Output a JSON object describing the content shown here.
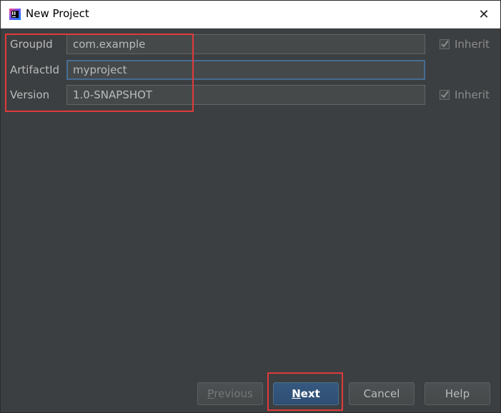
{
  "window": {
    "title": "New Project",
    "app_icon": "intellij-idea-icon",
    "close_icon": "close-icon",
    "close_glyph": "✕"
  },
  "form": {
    "group_id": {
      "label": "GroupId",
      "value": "com.example",
      "inherit_label": "Inherit",
      "inherit_checked": true
    },
    "artifact_id": {
      "label": "ArtifactId",
      "value": "myproject"
    },
    "version": {
      "label": "Version",
      "value": "1.0-SNAPSHOT",
      "inherit_label": "Inherit",
      "inherit_checked": true
    }
  },
  "buttons": {
    "previous": {
      "first": "P",
      "rest": "revious",
      "enabled": false
    },
    "next": {
      "first": "N",
      "rest": "ext",
      "default": true
    },
    "cancel": "Cancel",
    "help": "Help"
  },
  "colors": {
    "background": "#3c3f41",
    "highlight": "#e03a3a",
    "default_button": "#365880",
    "focus_border": "#466d94"
  }
}
